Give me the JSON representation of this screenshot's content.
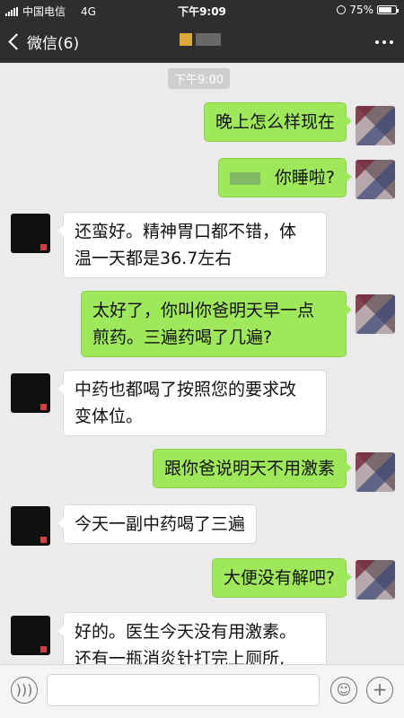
{
  "status": {
    "carrier": "中国电信",
    "network": "4G",
    "time": "下午9:09",
    "battery_percent": "75%",
    "battery_level": 0.75
  },
  "nav": {
    "back_label": "微信(6)"
  },
  "chat": {
    "timestamp": "下午9:00",
    "messages": [
      {
        "from": "me",
        "text": "晚上怎么样现在"
      },
      {
        "from": "me",
        "text": "你睡啦?"
      },
      {
        "from": "other",
        "line1": "还蛮好。精神胃口都不错，体",
        "line2": "温一天都是36.7左右"
      },
      {
        "from": "me",
        "line1": "太好了，你叫你爸明天早一点",
        "line2": "煎药。三遍药喝了几遍?"
      },
      {
        "from": "other",
        "line1": "中药也都喝了按照您的要求改",
        "line2": "变体位。"
      },
      {
        "from": "me",
        "text": "跟你爸说明天不用激素"
      },
      {
        "from": "other",
        "text": "今天一副中药喝了三遍"
      },
      {
        "from": "me",
        "text": "大便没有解吧?"
      },
      {
        "from": "other",
        "line1": "好的。医生今天没有用激素。",
        "line2": "还有一瓶消炎针打完上厕所,"
      }
    ]
  },
  "icons": {
    "voice": "voice-icon",
    "emoji": "emoji-icon",
    "add": "plus-icon"
  },
  "colors": {
    "outgoing_bubble": "#9fe85b",
    "incoming_bubble": "#ffffff",
    "header": "#2e2e2e",
    "background": "#ebebeb"
  }
}
